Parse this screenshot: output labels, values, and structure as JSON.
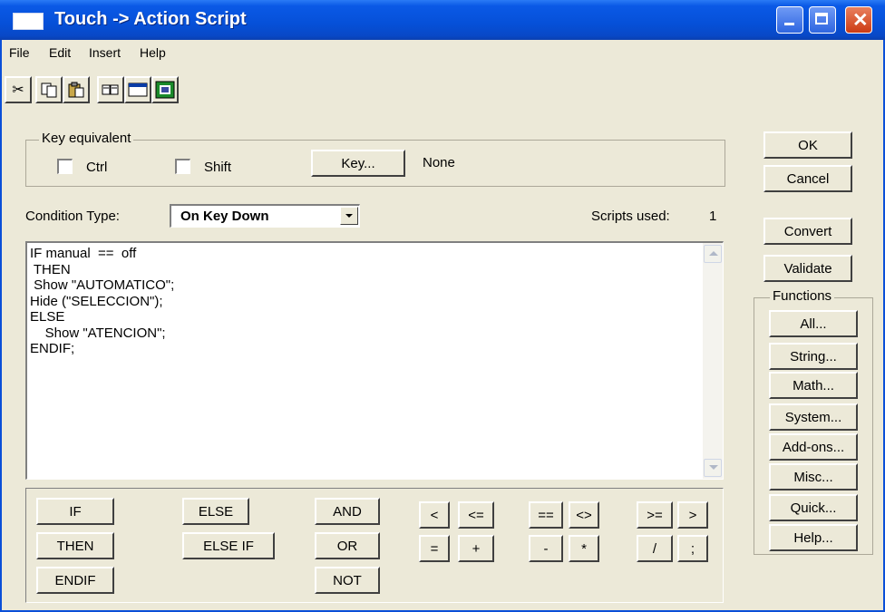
{
  "window": {
    "title": "Touch -> Action Script",
    "controls": {
      "minimize": "minimize-icon",
      "maximize": "maximize-icon",
      "close": "close-icon"
    }
  },
  "menu": [
    "File",
    "Edit",
    "Insert",
    "Help"
  ],
  "toolbar_icons": [
    "cut-icon",
    "copy-icon",
    "paste-icon",
    "find-icon",
    "window-icon",
    "image-icon"
  ],
  "key_equivalent": {
    "label": "Key equivalent",
    "ctrl_label": "Ctrl",
    "ctrl_checked": false,
    "shift_label": "Shift",
    "shift_checked": false,
    "key_button": "Key...",
    "key_value": "None"
  },
  "condition": {
    "label": "Condition Type:",
    "selected": "On Key Down",
    "scripts_used_label": "Scripts used:",
    "scripts_used_count": "1"
  },
  "script_text": "IF manual  ==  off\n THEN\n Show \"AUTOMATICO\";\nHide (\"SELECCION\");\nELSE\n    Show \"ATENCION\";\nENDIF;",
  "keyword_buttons": {
    "if": "IF",
    "then": "THEN",
    "endif": "ENDIF",
    "else": "ELSE",
    "else_if": "ELSE IF",
    "and": "AND",
    "or": "OR",
    "not": "NOT"
  },
  "operator_buttons": {
    "lt": "<",
    "le": "<=",
    "eq": "==",
    "ne": "<>",
    "ge": ">=",
    "gt": ">",
    "assign": "=",
    "plus": "+",
    "minus": "-",
    "mult": "*",
    "div": "/",
    "semicolon": ";"
  },
  "side_buttons": {
    "ok": "OK",
    "cancel": "Cancel",
    "convert": "Convert",
    "validate": "Validate"
  },
  "functions": {
    "label": "Functions",
    "all": "All...",
    "string": "String...",
    "math": "Math...",
    "system": "System...",
    "addons": "Add-ons...",
    "misc": "Misc...",
    "quick": "Quick...",
    "help": "Help..."
  }
}
